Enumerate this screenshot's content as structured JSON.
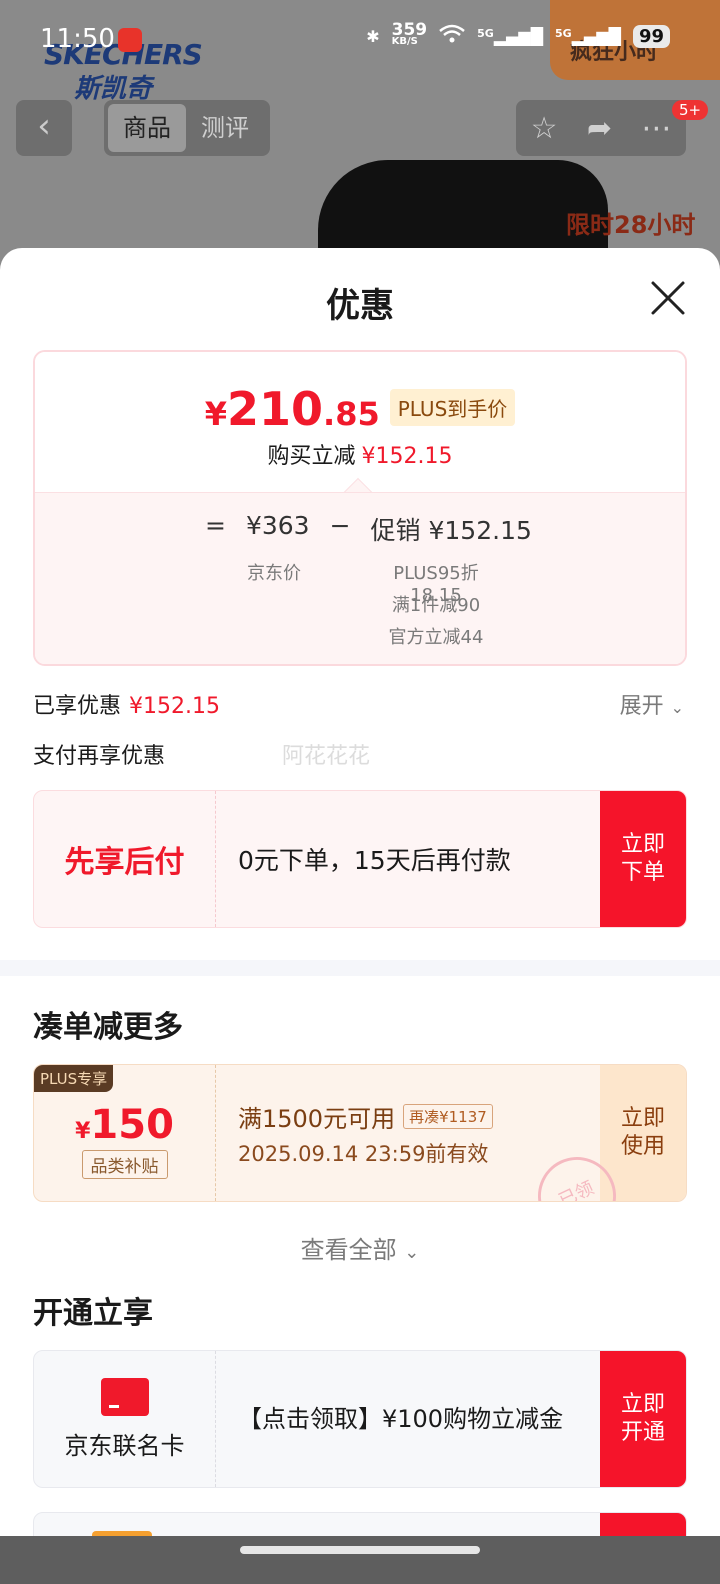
{
  "status_bar": {
    "time": "11:50",
    "net_speed": "359",
    "net_unit": "KB/S",
    "signal1": "5G",
    "signal2": "5G",
    "battery": "99"
  },
  "background": {
    "brand_en": "SKECHERS",
    "brand_cn": "斯凯奇",
    "promo_corner": "疯狂小时",
    "limited_badge": "限时28小时",
    "tabs": [
      "商品",
      "测评"
    ],
    "message_count": "5+"
  },
  "sheet": {
    "title": "优惠",
    "price_card": {
      "final_currency": "¥",
      "final_int": "210",
      "final_dec": ".85",
      "plus_tag": "PLUS到手价",
      "reduce_label": "购买立减",
      "reduce_amount": "¥152.15",
      "eq_sign": "=",
      "jd_price": "¥363",
      "minus_sign": "−",
      "promo_label": "促销",
      "promo_amount": "¥152.15",
      "jd_price_label": "京东价",
      "promo_details": [
        "PLUS95折18.15",
        "满1件减90",
        "官方立减44"
      ]
    },
    "enjoyed_label": "已享优惠",
    "enjoyed_amount": "¥152.15",
    "expand_label": "展开",
    "pay_more_label": "支付再享优惠",
    "watermark": "阿花花花",
    "bnpl": {
      "title": "先享后付",
      "desc": "0元下单，15天后再付款",
      "button_line1": "立即",
      "button_line2": "下单"
    },
    "section_more": "凑单减更多",
    "plus_coupon": {
      "badge": "PLUS专享",
      "currency": "¥",
      "amount": "150",
      "category": "品类补贴",
      "condition": "满1500元可用",
      "gap_tag": "再凑¥1137",
      "valid": "2025.09.14 23:59前有效",
      "button_line1": "立即",
      "button_line2": "使用",
      "stamp": "已领"
    },
    "view_all": "查看全部",
    "section_open": "开通立享",
    "card_coupon": {
      "name": "京东联名卡",
      "desc": "【点击领取】¥100购物立减金",
      "button_line1": "立即",
      "button_line2": "开通"
    }
  },
  "colors": {
    "accent_red": "#f0192b",
    "plus_brown": "#8a4a0e",
    "overlay_gray": "#8a8a8a"
  }
}
